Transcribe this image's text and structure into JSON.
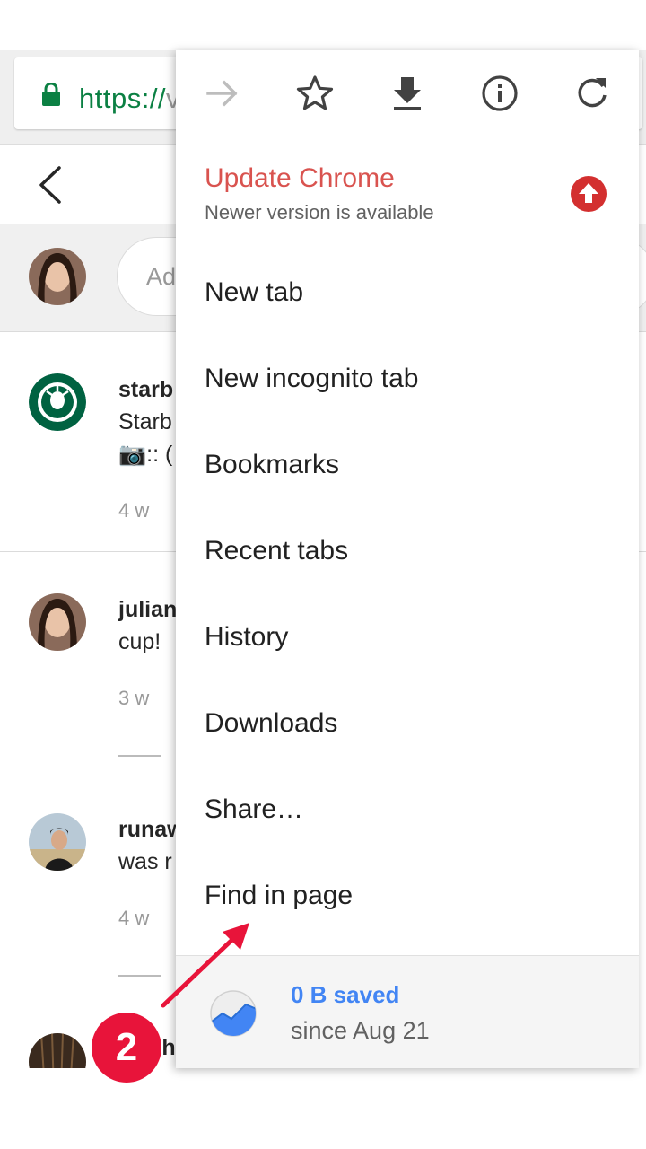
{
  "browser": {
    "url_visible": "https://",
    "url_tail": "v"
  },
  "page": {
    "comment_placeholder": "Ad",
    "posts": [
      {
        "user": "starb",
        "line1": "Starb",
        "line2": "📷:: (",
        "time": "4 w"
      },
      {
        "user": "julian",
        "line1": "cup!",
        "time": "3 w"
      },
      {
        "user": "runaw",
        "line1": "was r",
        "time": "4 w"
      },
      {
        "user": "th"
      }
    ]
  },
  "menu": {
    "toolbar": [
      "forward-icon",
      "star-icon",
      "download-icon",
      "info-icon",
      "reload-icon"
    ],
    "update": {
      "title": "Update Chrome",
      "subtitle": "Newer version is available"
    },
    "items": [
      "New tab",
      "New incognito tab",
      "Bookmarks",
      "Recent tabs",
      "History",
      "Downloads",
      "Share…",
      "Find in page"
    ],
    "footer": {
      "title": "0 B saved",
      "subtitle": "since Aug 21"
    }
  },
  "annotation": {
    "step": "2"
  },
  "colors": {
    "update_red": "#d9534f",
    "badge_red": "#e8143a",
    "saver_blue": "#4285f4",
    "url_green": "#0b8043"
  }
}
